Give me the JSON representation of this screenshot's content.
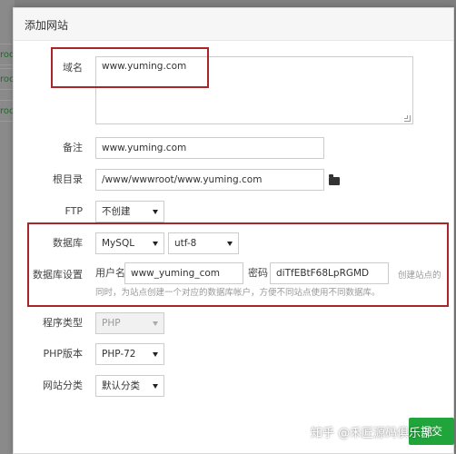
{
  "backdrop": {
    "fragments": [
      "root",
      "roc",
      "roc"
    ]
  },
  "dialog": {
    "title": "添加网站"
  },
  "form": {
    "domain": {
      "label": "域名",
      "value": "www.yuming.com"
    },
    "note": {
      "label": "备注",
      "value": "www.yuming.com"
    },
    "root_dir": {
      "label": "根目录",
      "value": "/www/wwwroot/www.yuming.com",
      "icon": "folder-icon"
    },
    "ftp": {
      "label": "FTP",
      "selected": "不创建"
    },
    "database": {
      "label": "数据库",
      "type_selected": "MySQL",
      "charset_selected": "utf-8"
    },
    "db_settings": {
      "label": "数据库设置",
      "username_label": "用户名",
      "username_value": "www_yuming_com",
      "password_label": "密码",
      "password_value": "diTfEBtF68LpRGMD",
      "hint_right": "创建站点的",
      "hint_line": "同时，为站点创建一个对应的数据库帐户，方便不同站点使用不同数据库。"
    },
    "program_type": {
      "label": "程序类型",
      "selected": "PHP"
    },
    "php_version": {
      "label": "PHP版本",
      "selected": "PHP-72"
    },
    "category": {
      "label": "网站分类",
      "selected": "默认分类"
    }
  },
  "footer": {
    "submit_label": "提交",
    "watermark": "知乎 @禾匠源码俱乐部"
  },
  "colors": {
    "highlight": "#a8262a",
    "primary_button": "#20a53a"
  }
}
